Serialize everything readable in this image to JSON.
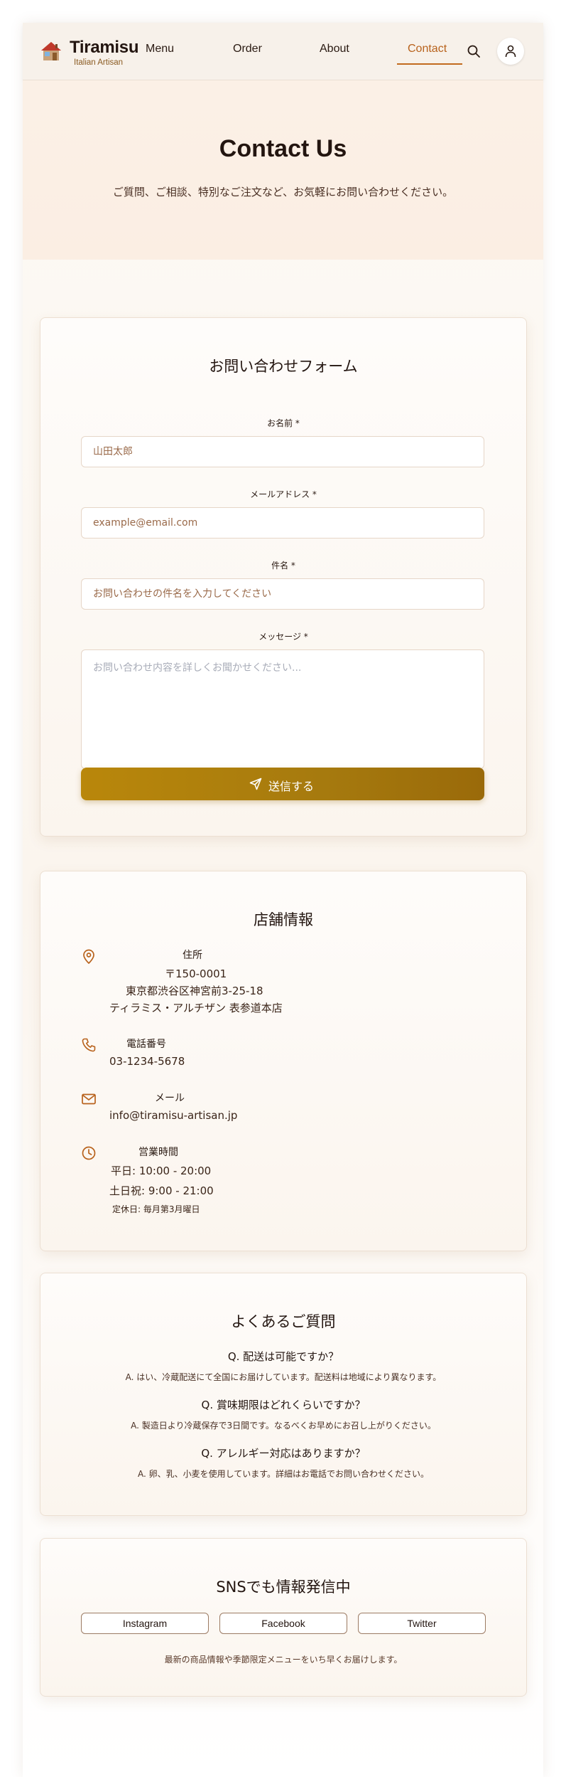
{
  "header": {
    "brand": "Tiramisu",
    "brand_sub": "Italian Artisan",
    "nav": [
      "Menu",
      "Order",
      "About",
      "Contact"
    ],
    "active_nav": "Contact",
    "icons": {
      "logo": "house-icon",
      "search": "search-icon",
      "user": "user-icon"
    }
  },
  "hero": {
    "title": "Contact Us",
    "subtitle": "ご質問、ご相談、特別なご注文など、お気軽にお問い合わせください。"
  },
  "form": {
    "title": "お問い合わせフォーム",
    "name_label": "お名前 *",
    "name_placeholder": "山田太郎",
    "email_label": "メールアドレス *",
    "email_placeholder": "example@email.com",
    "subject_label": "件名 *",
    "subject_placeholder": "お問い合わせの件名を入力してください",
    "message_label": "メッセージ *",
    "message_placeholder": "お問い合わせ内容を詳しくお聞かせください...",
    "submit_label": "送信する"
  },
  "store": {
    "title": "店舗情報",
    "address_label": "住所",
    "postal": "〒150-0001",
    "address_line1": "東京都渋谷区神宮前3-25-18",
    "address_line2": "ティラミス・アルチザン 表参道本店",
    "phone_label": "電話番号",
    "phone": "03-1234-5678",
    "email_label": "メール",
    "email": "info@tiramisu-artisan.jp",
    "hours_label": "営業時間",
    "weekday": "平日: 10:00 - 20:00",
    "weekend": "土日祝: 9:00 - 21:00",
    "closed": "定休日: 毎月第3月曜日"
  },
  "faq": {
    "title": "よくあるご質問",
    "items": [
      {
        "q": "Q. 配送は可能ですか？",
        "a": "A. はい、冷蔵配送にて全国にお届けしています。配送料は地域により異なります。"
      },
      {
        "q": "Q. 賞味期限はどれくらいですか？",
        "a": "A. 製造日より冷蔵保存で3日間です。なるべくお早めにお召し上がりください。"
      },
      {
        "q": "Q. アレルギー対応はありますか？",
        "a": "A. 卵、乳、小麦を使用しています。詳細はお電話でお問い合わせください。"
      }
    ]
  },
  "sns": {
    "title": "SNSでも情報発信中",
    "buttons": [
      "Instagram",
      "Facebook",
      "Twitter"
    ],
    "note": "最新の商品情報や季節限定メニューをいち早くお届けします。"
  },
  "colors": {
    "accent": "#c26a1e",
    "button": "#b9870b",
    "text": "#231510"
  }
}
